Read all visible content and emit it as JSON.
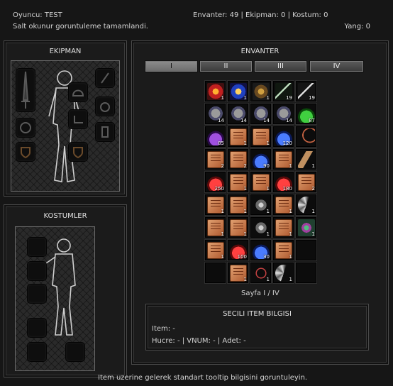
{
  "header": {
    "player_label": "Oyuncu: TEST",
    "status_message": "Salt okunur goruntuleme tamamlandi.",
    "counts": "Envanter: 49 | Ekipman: 0 | Kostum: 0",
    "yang": "Yang: 0"
  },
  "equipment": {
    "title": "EKIPMAN",
    "slot_icons": [
      "sword-icon",
      "helmet-icon",
      "necklace-icon",
      "earring-icon",
      "bracelet-icon",
      "shoes-icon",
      "unique-icon",
      "shield-icon",
      "ring-icon"
    ]
  },
  "costumes": {
    "title": "KOSTUMLER"
  },
  "inventory": {
    "title": "ENVANTER",
    "tabs": [
      "I",
      "II",
      "III",
      "IV"
    ],
    "active_tab": 0,
    "page_label": "Sayfa I / IV",
    "columns": 5,
    "cells": [
      {
        "icon": "armorred",
        "count": "1"
      },
      {
        "icon": "armorblue",
        "count": "1"
      },
      {
        "icon": "belt",
        "count": "1"
      },
      {
        "icon": "sword",
        "count": "19"
      },
      {
        "icon": "sword2",
        "count": "19"
      },
      {
        "icon": "helm",
        "count": "14"
      },
      {
        "icon": "helm",
        "count": "14"
      },
      {
        "icon": "helm",
        "count": "14"
      },
      {
        "icon": "helm",
        "count": "14"
      },
      {
        "icon": "green",
        "count": "87"
      },
      {
        "icon": "purple",
        "count": "85"
      },
      {
        "icon": "book",
        "count": "1"
      },
      {
        "icon": "book",
        "count": "1"
      },
      {
        "icon": "blue",
        "count": "120"
      },
      {
        "icon": "bow",
        "count": ""
      },
      {
        "icon": "book",
        "count": "2"
      },
      {
        "icon": "book",
        "count": "2"
      },
      {
        "icon": "blue",
        "count": "90"
      },
      {
        "icon": "book",
        "count": "1"
      },
      {
        "icon": "horn",
        "count": "1"
      },
      {
        "icon": "red",
        "count": "250"
      },
      {
        "icon": "book",
        "count": "1"
      },
      {
        "icon": "book",
        "count": "1"
      },
      {
        "icon": "red",
        "count": "180"
      },
      {
        "icon": "book",
        "count": "2"
      },
      {
        "icon": "book",
        "count": "1"
      },
      {
        "icon": "book",
        "count": "1"
      },
      {
        "icon": "claw",
        "count": "1"
      },
      {
        "icon": "book",
        "count": "1"
      },
      {
        "icon": "fan",
        "count": "1"
      },
      {
        "icon": "book",
        "count": "1"
      },
      {
        "icon": "book",
        "count": "1"
      },
      {
        "icon": "claw",
        "count": "1"
      },
      {
        "icon": "book",
        "count": "1"
      },
      {
        "icon": "bracelet",
        "count": "1"
      },
      {
        "icon": "book",
        "count": "1"
      },
      {
        "icon": "red",
        "count": "100"
      },
      {
        "icon": "blue",
        "count": "30"
      },
      {
        "icon": "book",
        "count": "1"
      },
      {
        "icon": "",
        "count": ""
      },
      {
        "icon": "",
        "count": ""
      },
      {
        "icon": "book",
        "count": "1"
      },
      {
        "icon": "necklace",
        "count": "1"
      },
      {
        "icon": "fan",
        "count": "1"
      },
      {
        "icon": "",
        "count": ""
      }
    ]
  },
  "item_info": {
    "title": "SECILI ITEM BILGISI",
    "item_line": "Item: -",
    "detail_line": "Hucre: - | VNUM: - | Adet: -"
  },
  "footer": {
    "hint": "Item uzerine gelerek standart tooltip bilgisini goruntuleyin."
  }
}
